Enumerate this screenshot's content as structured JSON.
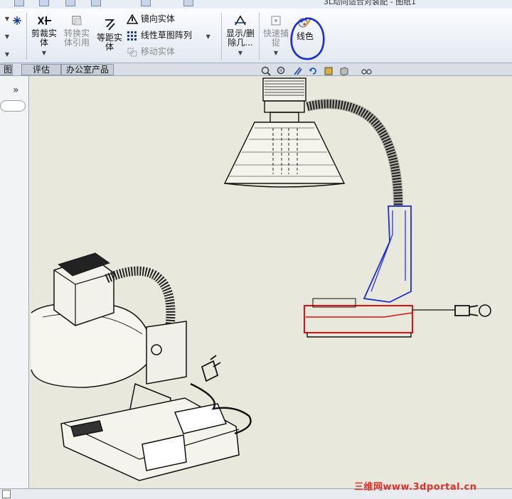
{
  "window": {
    "title": "3L动向适合对装配 - 图纸1"
  },
  "ribbon": {
    "trim_entities": "剪裁实体",
    "convert_entities": "转换实体引用",
    "offset_entities": "等距实体",
    "mirror_entities": "镜向实体",
    "linear_pattern": "线性草图阵列",
    "move_entities": "移动实体",
    "display_delete": "显示/删除几...",
    "quick_snap": "快速捕捉",
    "line_color": "线色"
  },
  "tabs": [
    "评估",
    "办公室产品"
  ],
  "left_panel": {
    "side_label": "图"
  },
  "watermark": "三维网www.3dportal.cn",
  "colors": {
    "annotation_circle": "#1a2bd8",
    "highlight_red": "#e01010",
    "highlight_blue": "#1a2bd8"
  },
  "icons": {
    "view_toolbar": [
      "zoom-to-fit-icon",
      "zoom-area-icon",
      "pan-icon",
      "rotate-icon",
      "section-view-icon",
      "display-style-icon",
      "hide-show-icon"
    ]
  }
}
